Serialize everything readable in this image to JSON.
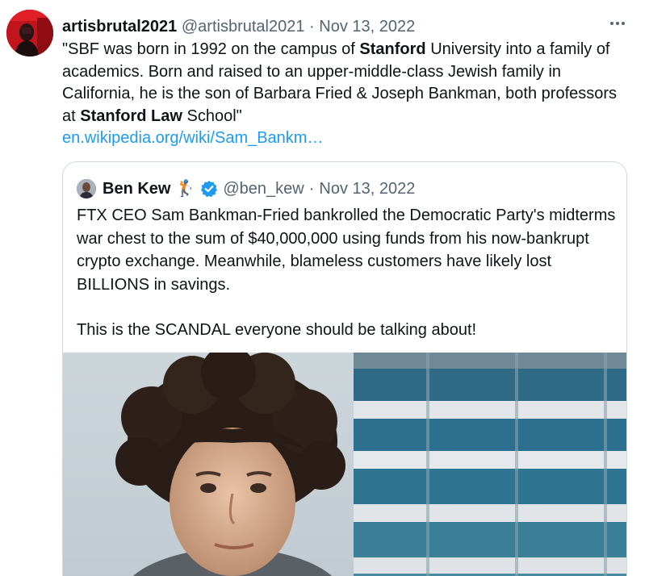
{
  "tweet": {
    "display_name": "artisbrutal2021",
    "handle": "@artisbrutal2021",
    "separator": "·",
    "date": "Nov 13, 2022",
    "more_icon": "more-horizontal-icon",
    "text_segments": [
      {
        "text": "\"SBF was born in 1992 on the campus of ",
        "bold": false
      },
      {
        "text": "Stanford",
        "bold": true
      },
      {
        "text": " University into a family of academics. Born and raised to an upper-middle-class Jewish family in California, he is the son of Barbara Fried & Joseph Bankman, both professors at ",
        "bold": false
      },
      {
        "text": "Stanford Law",
        "bold": true
      },
      {
        "text": " School\"",
        "bold": false
      }
    ],
    "link": "en.wikipedia.org/wiki/Sam_Bankm…"
  },
  "quote": {
    "display_name": "Ben Kew",
    "emoji": "🏌",
    "emoji_icon": "golfer-emoji-icon",
    "verified_icon": "verified-badge-icon",
    "handle": "@ben_kew",
    "separator": "·",
    "date": "Nov 13, 2022",
    "paragraphs": [
      "FTX CEO Sam Bankman-Fried bankrolled the Democratic Party's midterms war chest to the sum of $40,000,000 using funds from his now-bankrupt crypto exchange. Meanwhile, blameless customers have likely lost BILLIONS in savings.",
      "This is the SCANDAL everyone should be talking about!"
    ],
    "image": "photo-of-man-with-curly-hair-in-front-of-building"
  },
  "colors": {
    "text": "#0f1419",
    "muted": "#536471",
    "link": "#1d9bf0",
    "border": "#cfd9de",
    "verified": "#1d9bf0"
  }
}
